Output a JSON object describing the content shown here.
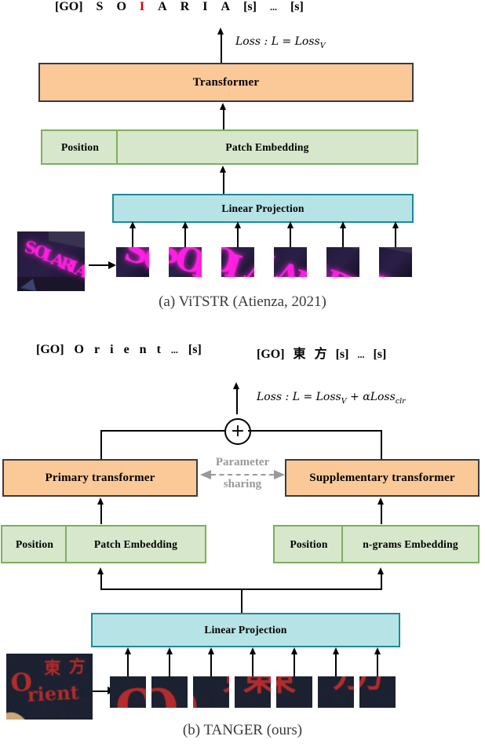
{
  "figure": {
    "panel_a": {
      "caption": "(a) ViTSTR (Atienza, 2021)",
      "output_sequence": [
        {
          "t": "[GO]",
          "color": "black"
        },
        {
          "t": "S",
          "color": "black"
        },
        {
          "t": "O",
          "color": "black"
        },
        {
          "t": "I",
          "color": "red"
        },
        {
          "t": "A",
          "color": "black"
        },
        {
          "t": "R",
          "color": "black"
        },
        {
          "t": "I",
          "color": "black"
        },
        {
          "t": "A",
          "color": "black"
        },
        {
          "t": "[s]",
          "color": "black"
        },
        {
          "t": "...",
          "color": "black"
        },
        {
          "t": "[s]",
          "color": "black"
        }
      ],
      "loss_label": "Loss : L = Loss",
      "loss_sub": "V",
      "transformer_label": "Transformer",
      "position_label": "Position",
      "patch_embedding_label": "Patch Embedding",
      "linear_projection_label": "Linear Projection",
      "source_image_alt": "SOLARIA neon sign",
      "patch_count": 6
    },
    "panel_b": {
      "caption": "(b) TANGER (ours)",
      "output_sequence_left": [
        {
          "t": "[GO]"
        },
        {
          "t": "O"
        },
        {
          "t": "r"
        },
        {
          "t": "i"
        },
        {
          "t": "e"
        },
        {
          "t": "n"
        },
        {
          "t": "t"
        },
        {
          "t": "..."
        },
        {
          "t": "[s]"
        }
      ],
      "output_sequence_right": [
        {
          "t": "[GO]"
        },
        {
          "t": "東"
        },
        {
          "t": "方"
        },
        {
          "t": "[s]"
        },
        {
          "t": "..."
        },
        {
          "t": "[s]"
        }
      ],
      "loss_label": "Loss : L = Loss",
      "loss_sub_1": "V",
      "loss_plus": " + αLoss",
      "loss_sub_2": "clr",
      "sum_symbol": "+",
      "primary_transformer_label": "Primary transformer",
      "supplementary_transformer_label": "Supplementary transformer",
      "parameter_sharing_line1": "Parameter",
      "parameter_sharing_line2": "sharing",
      "position_label_left": "Position",
      "patch_embedding_label": "Patch Embedding",
      "position_label_right": "Position",
      "ngrams_embedding_label": "n-grams Embedding",
      "linear_projection_label": "Linear Projection",
      "source_image_alt": "Orient 東方 graffiti",
      "patch_count": 7
    }
  },
  "colors": {
    "orange_fill": "#fbc997",
    "orange_border": "#3b3b42",
    "green_fill": "#d7e7cb",
    "green_border": "#7dae5f",
    "teal_fill": "#b6e3e6",
    "teal_border": "#1b8b95",
    "highlight_red": "#cc0000",
    "param_gray": "#999999",
    "caption_gray": "#3a3a3a"
  }
}
